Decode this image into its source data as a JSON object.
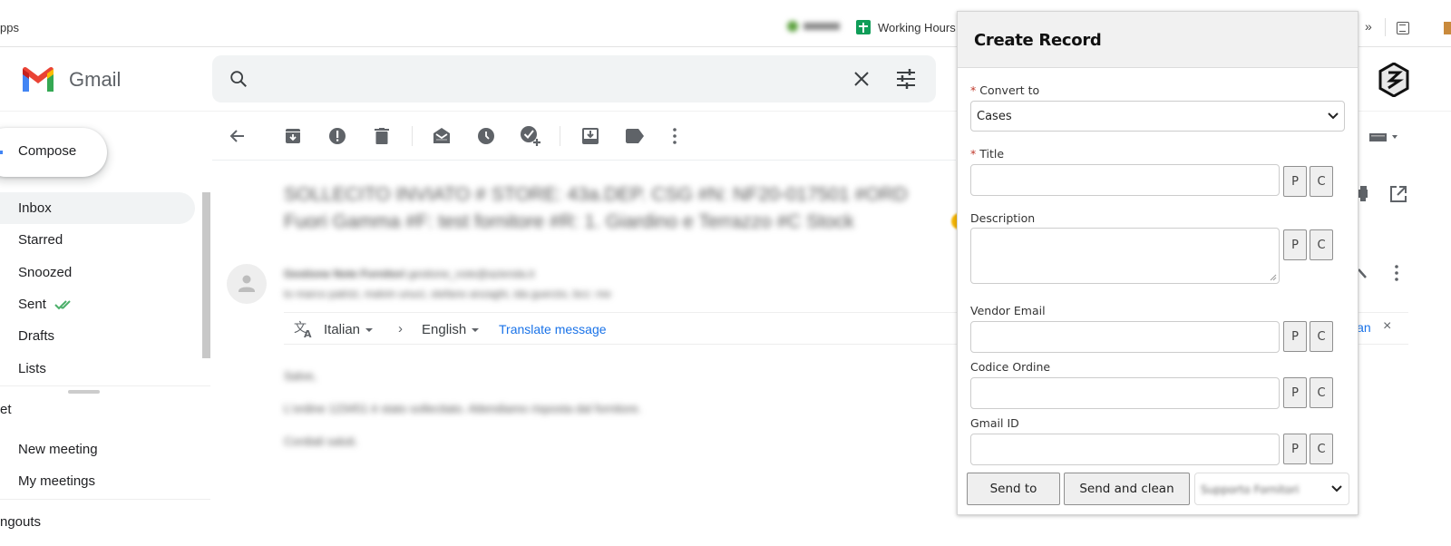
{
  "bookmarks": {
    "apps_label": "pps",
    "blurred_item": "Gmail",
    "working_hours": "Working Hours",
    "more_label": "»"
  },
  "gmail": {
    "brand": "Gmail",
    "search": {
      "value": "",
      "placeholder": ""
    },
    "compose_label": "Compose",
    "nav": [
      {
        "label": "Inbox",
        "active": true
      },
      {
        "label": "Starred"
      },
      {
        "label": "Snoozed"
      },
      {
        "label": "Sent"
      },
      {
        "label": "Drafts"
      },
      {
        "label": "Lists"
      }
    ],
    "meet": {
      "title": "et",
      "items": [
        "New meeting",
        "My meetings"
      ]
    },
    "hangouts_title": "ngouts",
    "message": {
      "subject_line1": "SOLLECITO INVIATO # STORE: 43a.DEP. CSG #N: NF20-017501 #ORD",
      "subject_line2": "Fuori Gamma #F: test fornitore #R: 1. Giardino e Terrazzo #C Stock",
      "sender_name": "Gestione Note Fornitori",
      "sender_email": "gestione_note@azienda.it",
      "recipients": "to marco patrizi, malvin unuci, stefano anzaghi, ida guerzio, bcc: me",
      "body": [
        "Salve,",
        "L'ordine 123451 è stato sollecitato. Attendiamo risposta dal fornitore.",
        "Cordiali saluti."
      ]
    },
    "translate": {
      "source_lang": "Italian",
      "target_lang": "English",
      "action": "Translate message",
      "tail": "ian"
    }
  },
  "panel": {
    "title": "Create Record",
    "convert_to": {
      "label": "Convert to",
      "required": true,
      "value": "Cases"
    },
    "fields": [
      {
        "label": "Title",
        "required": true,
        "value": ""
      },
      {
        "label": "Description",
        "required": false,
        "value": ""
      },
      {
        "label": "Vendor Email",
        "required": false,
        "value": ""
      },
      {
        "label": "Codice Ordine",
        "required": false,
        "value": ""
      },
      {
        "label": "Gmail ID",
        "required": false,
        "value": ""
      }
    ],
    "p_label": "P",
    "c_label": "C",
    "send_to": "Send to",
    "send_and_clean": "Send and clean",
    "target_select_value": "Supporto Fornitori",
    "required_mark": "*"
  }
}
